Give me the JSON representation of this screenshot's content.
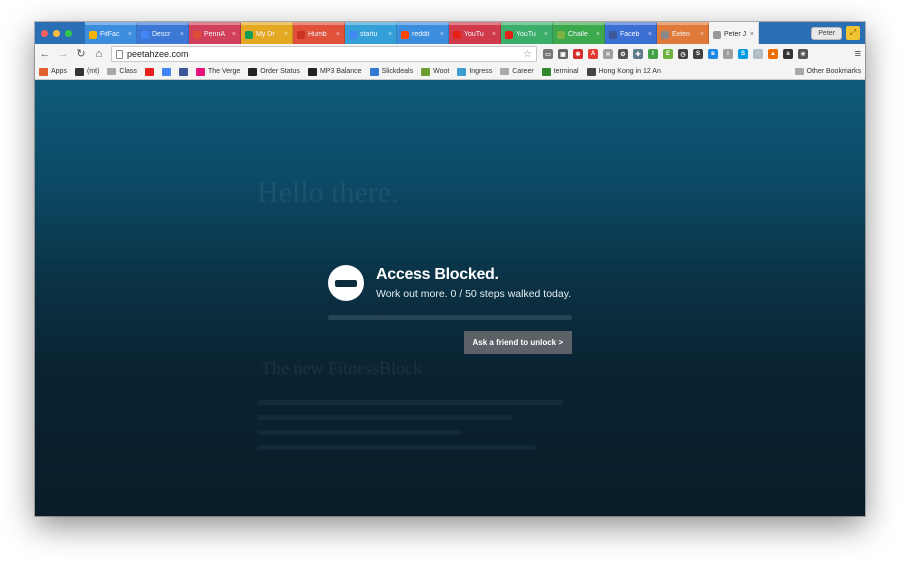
{
  "browser": {
    "tabs": [
      {
        "label": "FitFac",
        "color": "#3c8dde",
        "icon": "drive-icon",
        "icon_color": "#f4b400"
      },
      {
        "label": "Descr",
        "color": "#3d78d6",
        "icon": "docs-icon",
        "icon_color": "#4285f4"
      },
      {
        "label": "PennA",
        "color": "#d0405a",
        "icon": "gmail-icon",
        "icon_color": "#dd4b39"
      },
      {
        "label": "My Dr",
        "color": "#e5a823",
        "icon": "drive-icon",
        "icon_color": "#0f9d58"
      },
      {
        "label": "Humb",
        "color": "#e0503a",
        "icon": "humble-icon",
        "icon_color": "#cc3322"
      },
      {
        "label": "startu",
        "color": "#35a0d8",
        "icon": "google-icon",
        "icon_color": "#4285f4"
      },
      {
        "label": "reddit",
        "color": "#3c8dde",
        "icon": "reddit-icon",
        "icon_color": "#ff4500"
      },
      {
        "label": "YouTu",
        "color": "#d03a4a",
        "icon": "youtube-icon",
        "icon_color": "#e62117"
      },
      {
        "label": "YouTu",
        "color": "#3bae6a",
        "icon": "youtube-icon",
        "icon_color": "#e62117"
      },
      {
        "label": "Challe",
        "color": "#3ca94c",
        "icon": "challenge-icon",
        "icon_color": "#7cb342"
      },
      {
        "label": "Faceb",
        "color": "#3c6fd4",
        "icon": "facebook-icon",
        "icon_color": "#3b5998"
      },
      {
        "label": "Exten",
        "color": "#e07a3a",
        "icon": "puzzle-icon",
        "icon_color": "#888888"
      },
      {
        "label": "Peter J",
        "color": "#f4f4f4",
        "icon": "page-icon",
        "icon_color": "#999999",
        "active": true
      }
    ],
    "profile_name": "Peter",
    "url": "peetahzee.com",
    "extensions": [
      {
        "icon": "cast-icon",
        "color": "#777777",
        "glyph": "▭"
      },
      {
        "icon": "screen-icon",
        "color": "#666666",
        "glyph": "▣"
      },
      {
        "icon": "lastpass-icon",
        "color": "#d32f2f",
        "glyph": "✱"
      },
      {
        "icon": "adblock-icon",
        "color": "#e53935",
        "glyph": "A"
      },
      {
        "icon": "tools-icon",
        "color": "#9e9e9e",
        "glyph": "✕"
      },
      {
        "icon": "gear-icon",
        "color": "#555555",
        "glyph": "⚙"
      },
      {
        "icon": "puzzle-badge-icon",
        "color": "#607d8b",
        "glyph": "✚"
      },
      {
        "icon": "ingress-icon",
        "color": "#43a047",
        "glyph": "I"
      },
      {
        "icon": "evernote-icon",
        "color": "#6cb33f",
        "glyph": "E"
      },
      {
        "icon": "clock-icon",
        "color": "#444444",
        "glyph": "◷"
      },
      {
        "icon": "stop-icon",
        "color": "#424242",
        "glyph": "S"
      },
      {
        "icon": "bluetooth-icon",
        "color": "#1e88e5",
        "glyph": "ʙ"
      },
      {
        "icon": "info-icon",
        "color": "#9e9e9e",
        "glyph": "i"
      },
      {
        "icon": "skype-icon",
        "color": "#039be5",
        "glyph": "S"
      },
      {
        "icon": "ghost-icon",
        "color": "#b0bec5",
        "glyph": "◌"
      },
      {
        "icon": "fire-icon",
        "color": "#ef6c00",
        "glyph": "▲"
      },
      {
        "icon": "amazon-icon",
        "color": "#333333",
        "glyph": "a"
      },
      {
        "icon": "puzzle-icon",
        "color": "#555555",
        "glyph": "✳"
      }
    ],
    "bookmarks": [
      {
        "label": "Apps",
        "icon": "apps-grid-icon",
        "color": "#e06030"
      },
      {
        "label": "(mt)",
        "icon": "mt-icon",
        "color": "#333333"
      },
      {
        "label": "Class",
        "icon": "folder-icon",
        "color": "#a8a8a8"
      },
      {
        "label": "",
        "icon": "youtube-icon",
        "color": "#e62117"
      },
      {
        "label": "",
        "icon": "calendar-icon",
        "color": "#4285f4"
      },
      {
        "label": "",
        "icon": "facebook-icon",
        "color": "#3b5998"
      },
      {
        "label": "The Verge",
        "icon": "verge-icon",
        "color": "#e5127d"
      },
      {
        "label": "Order Status",
        "icon": "amazon-icon",
        "color": "#222222"
      },
      {
        "label": "MP3 Balance",
        "icon": "amazon-icon",
        "color": "#222222"
      },
      {
        "label": "Slickdeals",
        "icon": "slickdeals-icon",
        "color": "#2e7bcf"
      },
      {
        "label": "Woot",
        "icon": "woot-icon",
        "color": "#6b9f2f"
      },
      {
        "label": "Ingress",
        "icon": "ingress-icon",
        "color": "#3d9cd2"
      },
      {
        "label": "Career",
        "icon": "folder-icon",
        "color": "#a8a8a8"
      },
      {
        "label": "terminal",
        "icon": "terminal-icon",
        "color": "#2f8a2f"
      },
      {
        "label": "Hong Kong in 12 An",
        "icon": "camera-icon",
        "color": "#444444"
      }
    ],
    "other_bookmarks": "Other Bookmarks"
  },
  "page": {
    "background_heading": "Hello there.",
    "background_subheading": "The new FitnessBlock",
    "blocked": {
      "title": "Access Blocked.",
      "message": "Work out more. 0 / 50 steps walked today.",
      "steps_walked": 0,
      "steps_goal": 50,
      "progress_fraction": 0,
      "unlock_label": "Ask a friend to unlock >"
    }
  }
}
